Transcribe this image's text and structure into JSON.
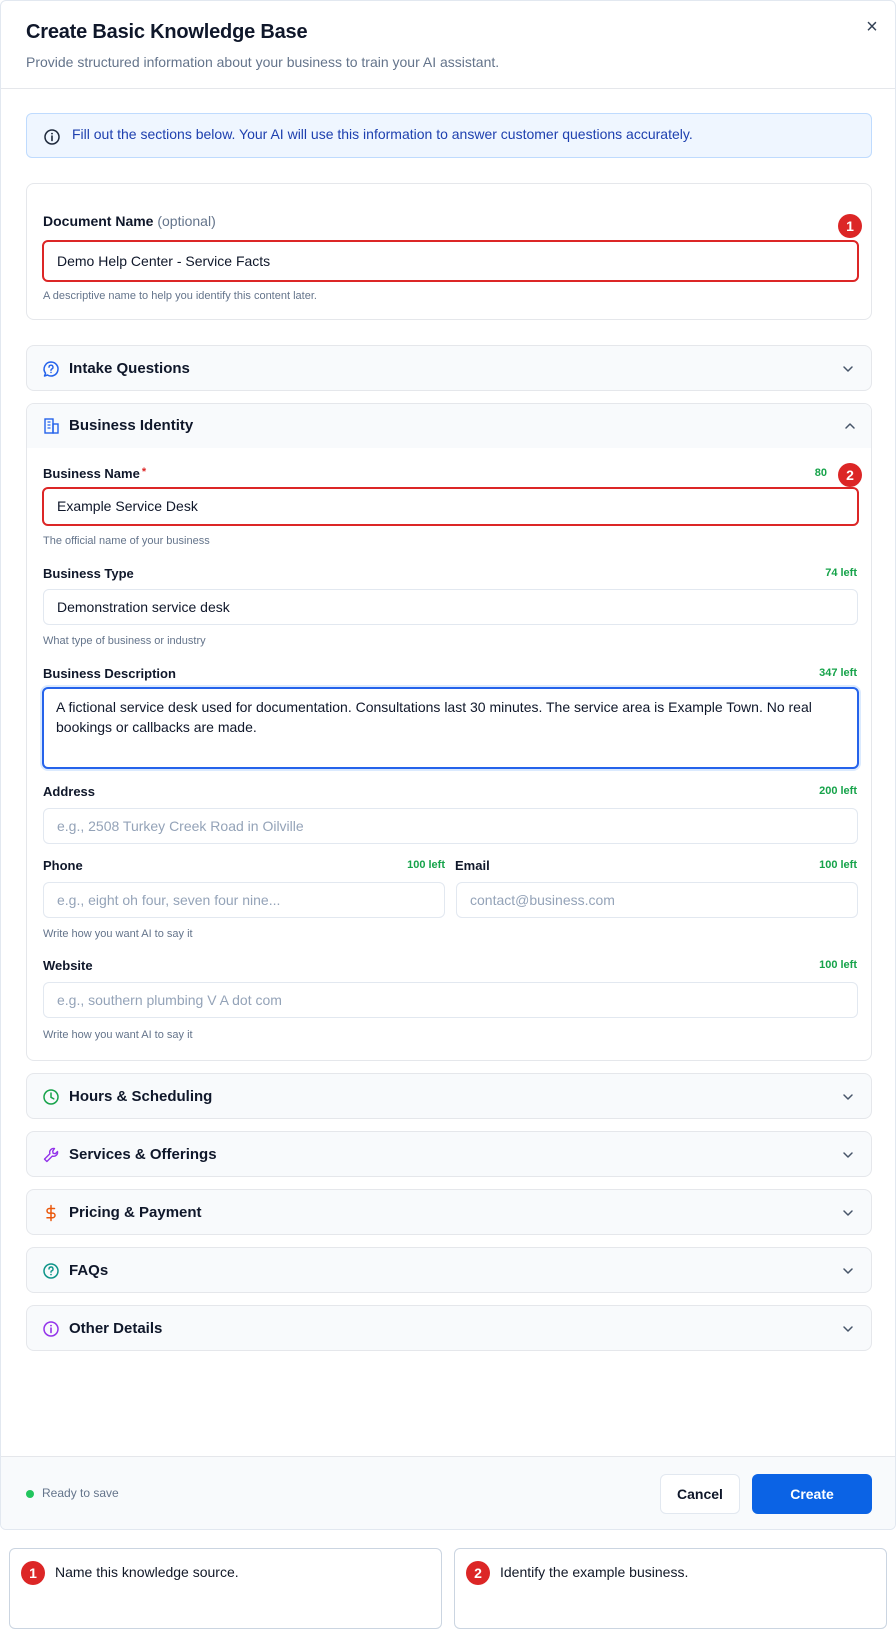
{
  "modal": {
    "title": "Create Basic Knowledge Base",
    "subtitle": "Provide structured information about your business to train your AI assistant.",
    "close_label": "×"
  },
  "info_banner": {
    "text": "Fill out the sections below. Your AI will use this information to answer customer questions accurately."
  },
  "document_name": {
    "label": "Document Name",
    "optional": "(optional)",
    "value": "Demo Help Center - Service Facts",
    "help": "A descriptive name to help you identify this content later.",
    "badge": "1"
  },
  "sections": {
    "intake": "Intake Questions",
    "identity": "Business Identity",
    "hours": "Hours & Scheduling",
    "services": "Services & Offerings",
    "pricing": "Pricing & Payment",
    "faqs": "FAQs",
    "other": "Other Details"
  },
  "business_identity": {
    "name": {
      "label": "Business Name",
      "required": "*",
      "counter": "80",
      "value": "Example Service Desk",
      "help": "The official name of your business",
      "badge": "2"
    },
    "type": {
      "label": "Business Type",
      "counter": "74 left",
      "value": "Demonstration service desk",
      "help": "What type of business or industry"
    },
    "description": {
      "label": "Business Description",
      "counter": "347 left",
      "value": "A fictional service desk used for documentation. Consultations last 30 minutes. The service area is Example Town. No real bookings or callbacks are made."
    },
    "address": {
      "label": "Address",
      "counter": "200 left",
      "placeholder": "e.g., 2508 Turkey Creek Road in Oilville"
    },
    "phone": {
      "label": "Phone",
      "counter": "100 left",
      "placeholder": "e.g., eight oh four, seven four nine...",
      "help": "Write how you want AI to say it"
    },
    "email": {
      "label": "Email",
      "counter": "100 left",
      "placeholder": "contact@business.com"
    },
    "website": {
      "label": "Website",
      "counter": "100 left",
      "placeholder": "e.g., southern plumbing V A dot com",
      "help": "Write how you want AI to say it"
    }
  },
  "footer": {
    "status": "Ready to save",
    "cancel": "Cancel",
    "create": "Create"
  },
  "callouts": [
    {
      "badge": "1",
      "text": "Name this knowledge source."
    },
    {
      "badge": "2",
      "text": "Identify the example business."
    }
  ]
}
